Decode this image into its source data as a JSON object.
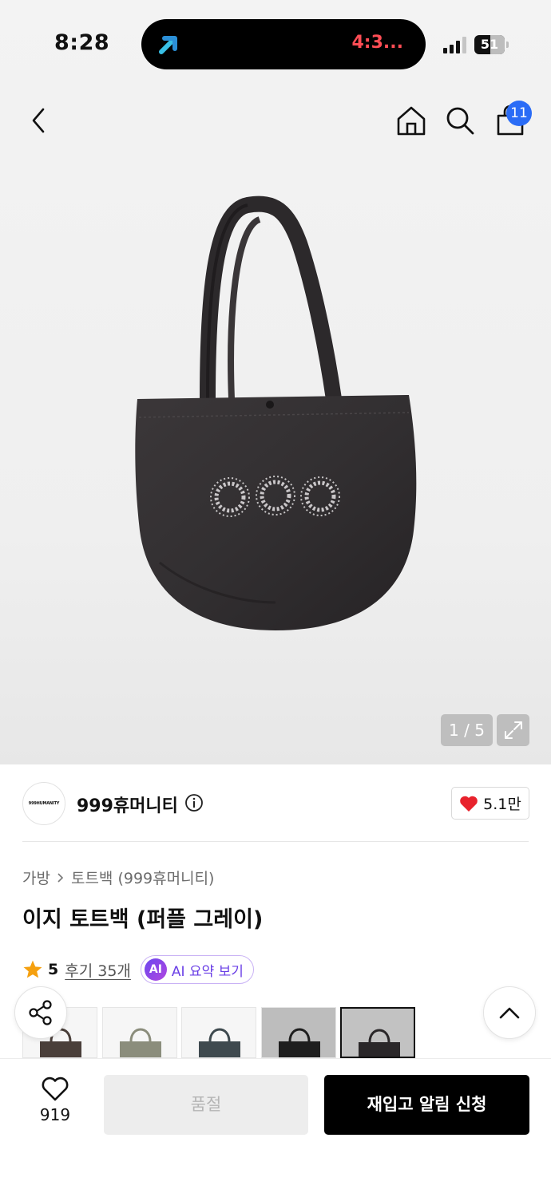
{
  "status_bar": {
    "time": "8:28",
    "timer": "4:3...",
    "battery": "51",
    "app_icon": "arrow-up-right-icon"
  },
  "nav": {
    "cart_count": "11",
    "icons": [
      "back-icon",
      "home-icon",
      "search-icon",
      "cart-icon"
    ]
  },
  "gallery": {
    "counter": "1 / 5",
    "expand_icon": "expand-icon"
  },
  "brand": {
    "logo_text": "999HUMANITY",
    "name": "999휴머니티",
    "likes": "5.1만",
    "heart_color": "#e8222c"
  },
  "product": {
    "breadcrumb": [
      "가방",
      "토트백 (999휴머니티)"
    ],
    "title": "이지 토트백 (퍼플 그레이)",
    "rating": "5",
    "review_link": "후기 35개",
    "ai_badge": "AI",
    "ai_label": "AI 요약 보기",
    "star_color": "#f5a00f"
  },
  "variants": [
    {
      "color": "#4a3f3a"
    },
    {
      "color": "#8b8d7c"
    },
    {
      "color": "#3f4a4f"
    },
    {
      "color": "#1e1e1e"
    },
    {
      "color": "#2a2729"
    }
  ],
  "bottom_bar": {
    "wish_count": "919",
    "soldout_label": "품절",
    "restock_label": "재입고 알림 신청"
  }
}
